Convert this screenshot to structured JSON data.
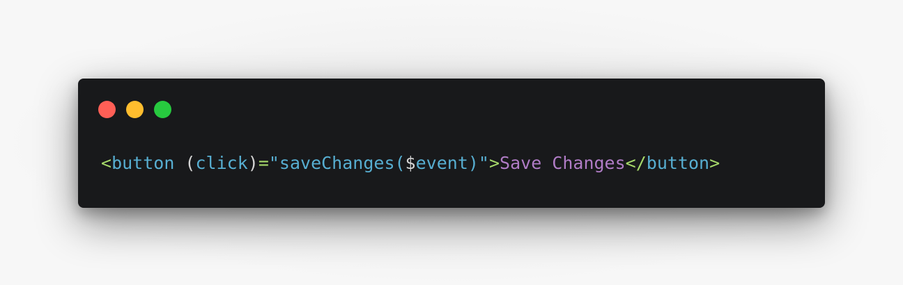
{
  "window": {
    "controls": [
      {
        "name": "close",
        "color": "#ff5f56"
      },
      {
        "name": "minimize",
        "color": "#ffbd2e"
      },
      {
        "name": "maximize",
        "color": "#27c93f"
      }
    ]
  },
  "code": {
    "tokens": [
      {
        "text": "<",
        "color": "#a6d96a"
      },
      {
        "text": "button",
        "color": "#57aed1"
      },
      {
        "text": " (",
        "color": "#d4d4d4"
      },
      {
        "text": "click",
        "color": "#57aed1"
      },
      {
        "text": ")",
        "color": "#d4d4d4"
      },
      {
        "text": "=",
        "color": "#a6d96a"
      },
      {
        "text": "\"saveChanges(",
        "color": "#57aed1"
      },
      {
        "text": "$",
        "color": "#d4d4d4"
      },
      {
        "text": "event",
        "color": "#57aed1"
      },
      {
        "text": ")\"",
        "color": "#57aed1"
      },
      {
        "text": ">",
        "color": "#a6d96a"
      },
      {
        "text": "Save Changes",
        "color": "#b07cc6"
      },
      {
        "text": "</",
        "color": "#a6d96a"
      },
      {
        "text": "button",
        "color": "#57aed1"
      },
      {
        "text": ">",
        "color": "#a6d96a"
      }
    ]
  }
}
